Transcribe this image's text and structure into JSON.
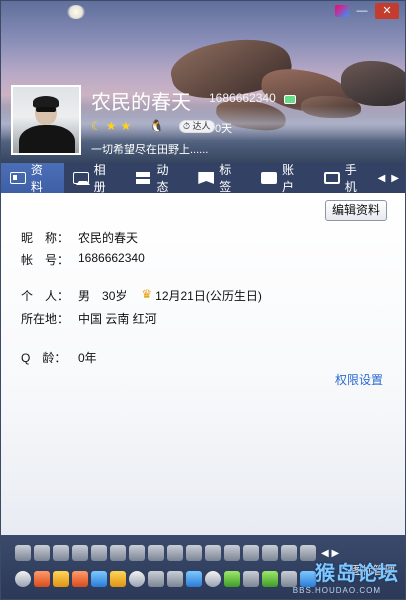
{
  "window": {
    "close_glyph": "✕",
    "minimize_glyph": "—"
  },
  "profile": {
    "nickname": "农民的春天",
    "qq_number": "1686662340",
    "level_badge": "达人",
    "online_days": "0天",
    "signature": "一切希望尽在田野上......"
  },
  "tabs": [
    {
      "label": "资料",
      "icon": "id-card-icon",
      "active": true
    },
    {
      "label": "相册",
      "icon": "photo-icon",
      "active": false
    },
    {
      "label": "动态",
      "icon": "feed-icon",
      "active": false
    },
    {
      "label": "标签",
      "icon": "tag-icon",
      "active": false
    },
    {
      "label": "账户",
      "icon": "wallet-icon",
      "active": false
    },
    {
      "label": "手机",
      "icon": "phone-icon",
      "active": false
    }
  ],
  "tab_arrows": {
    "left": "◀",
    "right": "▶"
  },
  "info": {
    "edit_button": "编辑资料",
    "nickname_label": "昵　称：",
    "nickname_value": "农民的春天",
    "account_label": "帐　号：",
    "account_value": "1686662340",
    "personal_label": "个　人：",
    "gender": "男",
    "age": "30岁",
    "birthday": "12月21日(公历生日)",
    "location_label": "所在地：",
    "location_value": "中国 云南 红河",
    "qage_label": "Q　龄：",
    "qage_value": "0年",
    "permissions_link": "权限设置"
  },
  "bottom_bar": {
    "more_arrows": "◀ ▶",
    "edit_label": "图标管理"
  },
  "watermark": {
    "cn": "猴岛论坛",
    "en": "BBS.HOUDAO.COM"
  },
  "colors": {
    "tab_bar": "#334264",
    "active_tab": "#3e5fa6",
    "link": "#2a6bd1",
    "close_button": "#c43c2e"
  }
}
